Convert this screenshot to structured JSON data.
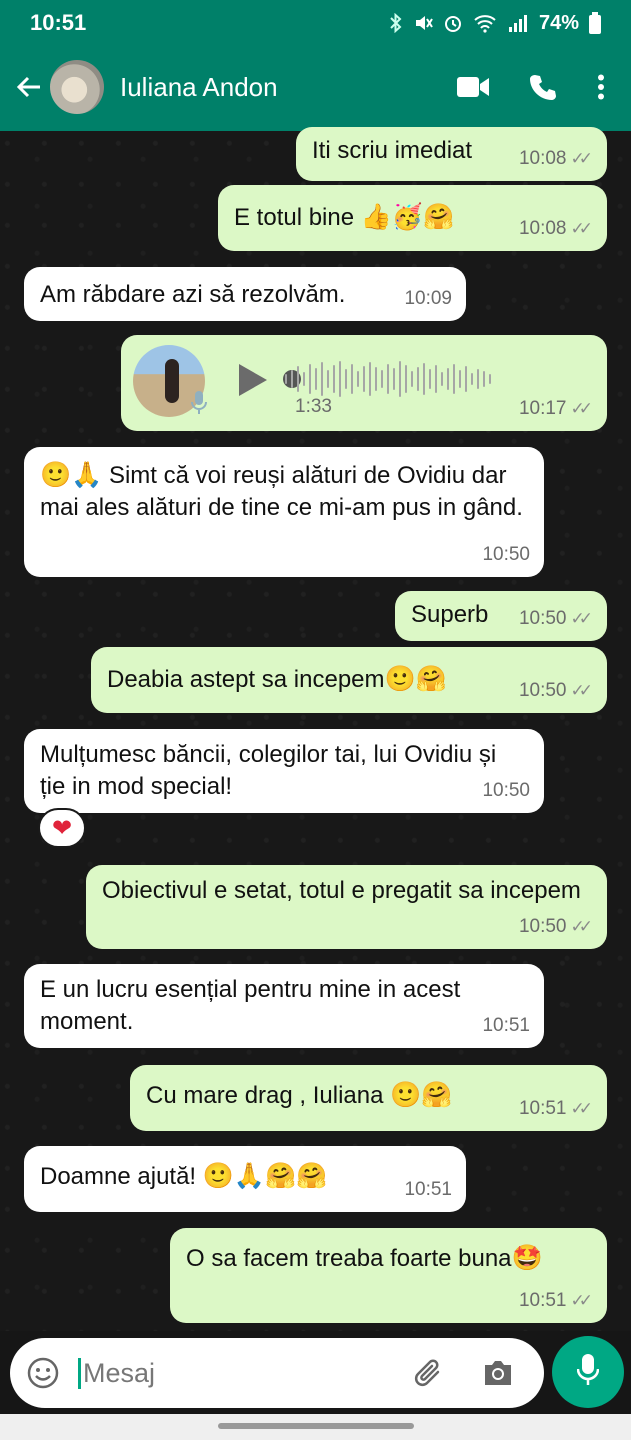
{
  "status_bar": {
    "time": "10:51",
    "battery": "74%"
  },
  "header": {
    "contact_name": "Iuliana Andon"
  },
  "messages": [
    {
      "dir": "out",
      "text": "Iti scriu imediat",
      "time": "10:08"
    },
    {
      "dir": "out",
      "text": "E totul bine",
      "emoji": "👍🥳🤗",
      "time": "10:08"
    },
    {
      "dir": "in",
      "text": "Am răbdare azi să rezolvăm.",
      "time": "10:09"
    },
    {
      "dir": "out",
      "type": "voice",
      "duration": "1:33",
      "time": "10:17"
    },
    {
      "dir": "in",
      "emoji": "🙂🙏",
      "text": "Simt că voi reuși alături de Ovidiu dar mai ales alături de tine ce mi-am pus in gând.",
      "time": "10:50"
    },
    {
      "dir": "out",
      "text": "Superb",
      "time": "10:50"
    },
    {
      "dir": "out",
      "text": "Deabia astept sa incepem",
      "emoji": "🙂🤗",
      "time": "10:50"
    },
    {
      "dir": "in",
      "text": "Mulțumesc băncii, colegilor tai, lui Ovidiu și ție in mod special!",
      "time": "10:50",
      "reaction": "❤"
    },
    {
      "dir": "out",
      "text": "Obiectivul e setat, totul e pregatit sa incepem",
      "time": "10:50"
    },
    {
      "dir": "in",
      "text": "E un lucru esențial pentru mine in acest moment.",
      "time": "10:51"
    },
    {
      "dir": "out",
      "text": "Cu mare drag , Iuliana",
      "emoji": "🙂🤗",
      "time": "10:51"
    },
    {
      "dir": "in",
      "text": "Doamne ajută!",
      "emoji": "🙂🙏🤗🤗",
      "time": "10:51"
    },
    {
      "dir": "out",
      "text": "O sa facem treaba foarte buna",
      "emoji": "🤩",
      "time": "10:51"
    }
  ],
  "composer": {
    "placeholder": "Mesaj"
  },
  "colors": {
    "header": "#008069",
    "outgoing": "#dcf8c6",
    "incoming": "#ffffff",
    "accent": "#00a884"
  },
  "icons": [
    "back-arrow-icon",
    "video-call-icon",
    "phone-icon",
    "more-vert-icon",
    "emoji-icon",
    "attach-icon",
    "camera-icon",
    "mic-icon",
    "play-icon",
    "double-check-icon",
    "heart-icon"
  ]
}
